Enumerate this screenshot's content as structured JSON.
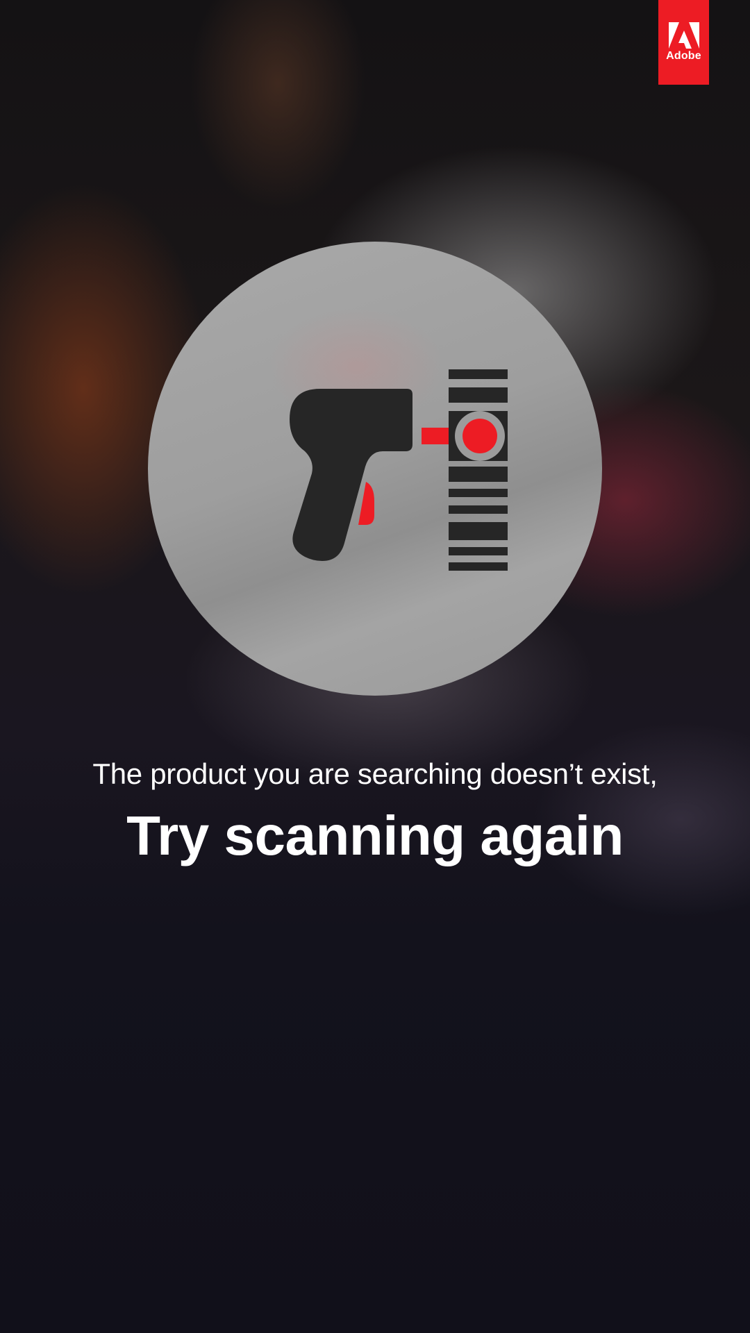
{
  "brand": {
    "name": "Adobe",
    "logo_icon": "adobe-a-icon",
    "color": "#ed1c24"
  },
  "illustration": {
    "icon": "barcode-scanner-icon",
    "accent_color": "#ed1c24",
    "dark_color": "#262626"
  },
  "message": {
    "line1": "The product you are searching doesn’t exist,",
    "line2": "Try scanning again"
  }
}
